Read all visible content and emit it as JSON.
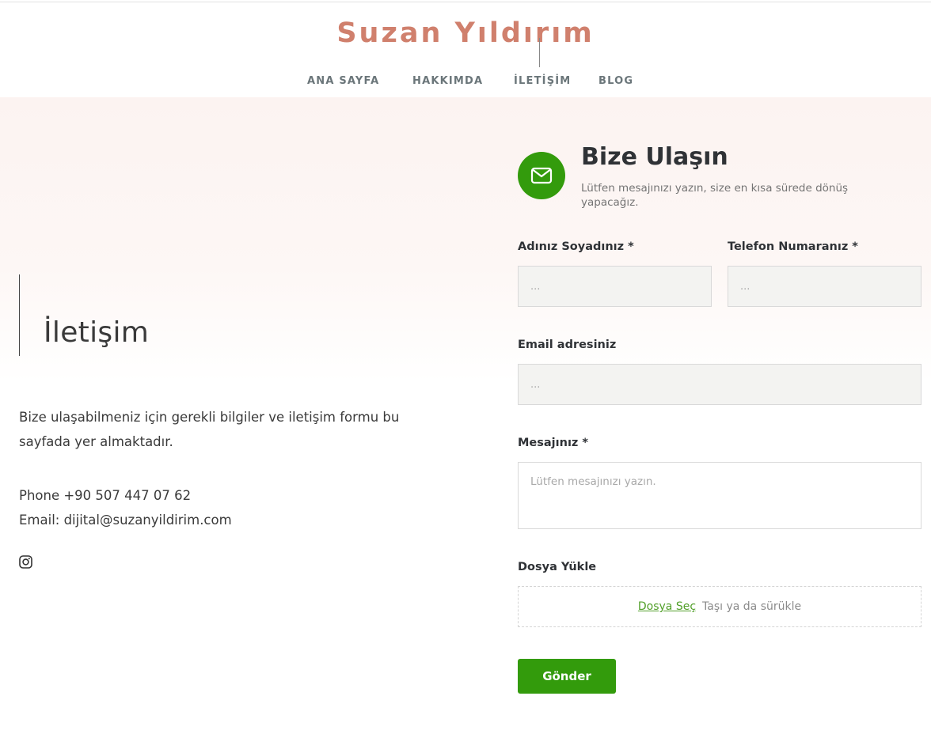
{
  "header": {
    "site_title": "Suzan Yıldırım",
    "nav": [
      {
        "label": "ANA SAYFA"
      },
      {
        "label": "HAKKIMDA"
      },
      {
        "label": "İLETİŞİM"
      },
      {
        "label": "BLOG"
      }
    ],
    "active_nav": "İLETİŞİM"
  },
  "contact_info": {
    "heading": "İletişim",
    "intro": "Bize ulaşabilmeniz için gerekli bilgiler ve iletişim formu bu sayfada yer almaktadır.",
    "phone": "Phone +90 507 447 07 62",
    "email": "Email: dijital@suzanyildirim.com",
    "social_icon": "instagram-icon"
  },
  "form": {
    "icon": "mail-icon",
    "title": "Bize Ulaşın",
    "subtitle": "Lütfen mesajınızı yazın, size en kısa sürede dönüş yapacağız.",
    "fields": {
      "name": {
        "label": "Adınız Soyadınız *",
        "placeholder": "...",
        "value": ""
      },
      "phone": {
        "label": "Telefon Numaranız *",
        "placeholder": "...",
        "value": ""
      },
      "email": {
        "label": "Email adresiniz",
        "placeholder": "...",
        "value": ""
      },
      "message": {
        "label": "Mesajınız *",
        "placeholder": "Lütfen mesajınızı yazın.",
        "value": ""
      },
      "file": {
        "label": "Dosya Yükle",
        "choose_label": "Dosya Seç",
        "drag_hint": "Taşı ya da sürükle"
      }
    },
    "submit_label": "Gönder"
  },
  "colors": {
    "title_accent": "#d0806d",
    "brand_green": "#339b0c",
    "link_green": "#52a02a",
    "hero_tint": "#fcf3f1"
  }
}
